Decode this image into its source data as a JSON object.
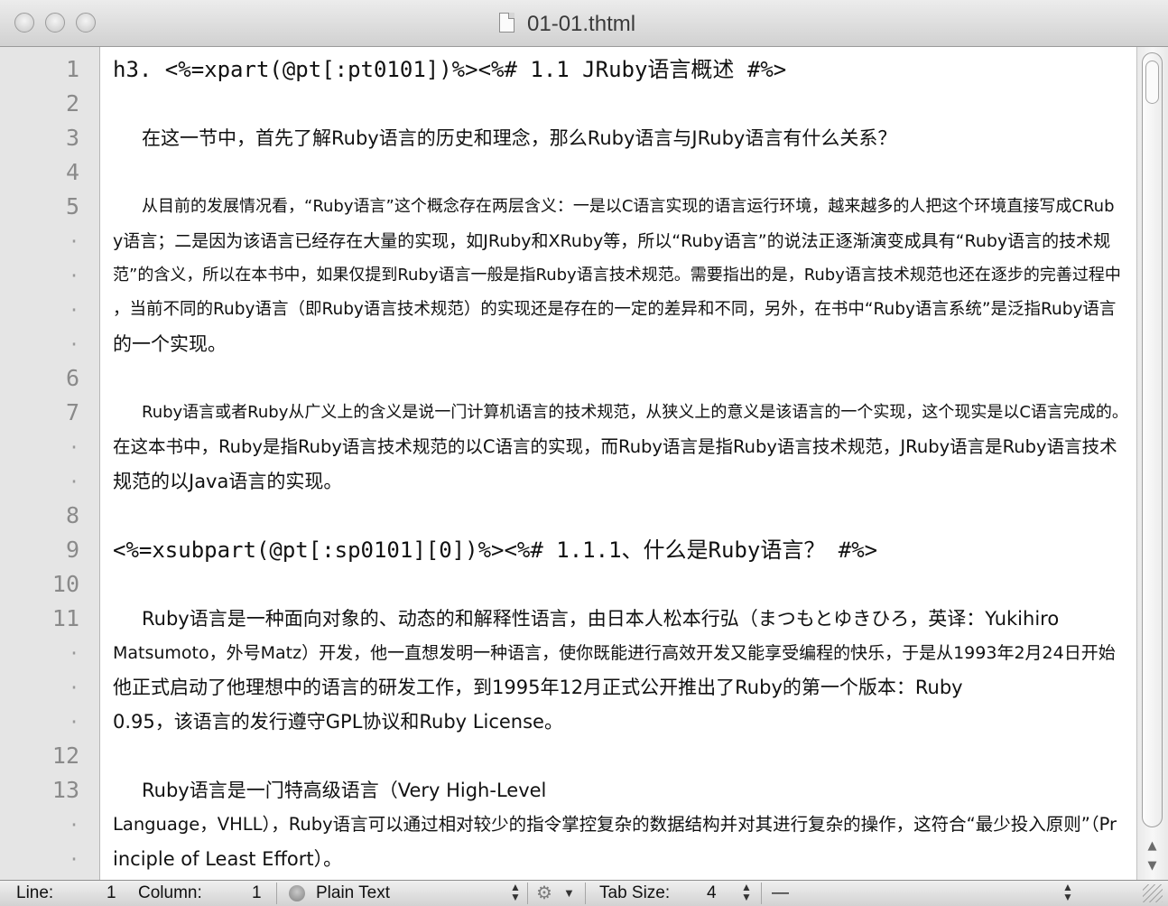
{
  "window": {
    "title": "01-01.thtml"
  },
  "gutter": [
    "1",
    "2",
    "3",
    "4",
    "5",
    "·",
    "·",
    "·",
    "·",
    "6",
    "7",
    "·",
    "·",
    "8",
    "9",
    "10",
    "11",
    "·",
    "·",
    "·",
    "12",
    "13",
    "·",
    "·"
  ],
  "lines": [
    "h3. <%=xpart(@pt[:pt0101])%><%# 1.1 JRuby语言概述 #%>",
    "",
    "在这一节中，首先了解Ruby语言的历史和理念，那么Ruby语言与JRuby语言有什么关系？",
    "",
    "从目前的发展情况看，“Ruby语言”这个概念存在两层含义：一是以C语言实现的语言运行环境，越来越多的人把这个环境直接写成CRub",
    "y语言；二是因为该语言已经存在大量的实现，如JRuby和XRuby等，所以“Ruby语言”的说法正逐渐演变成具有“Ruby语言的技术规",
    "范”的含义，所以在本书中，如果仅提到Ruby语言一般是指Ruby语言技术规范。需要指出的是，Ruby语言技术规范也还在逐步的完善过程中",
    "，当前不同的Ruby语言（即Ruby语言技术规范）的实现还是存在的一定的差异和不同，另外，在书中“Ruby语言系统”是泛指Ruby语言",
    "的一个实现。",
    "",
    "Ruby语言或者Ruby从广义上的含义是说一门计算机语言的技术规范，从狭义上的意义是该语言的一个实现，这个现实是以C语言完成的。",
    "在这本书中，Ruby是指Ruby语言技术规范的以C语言的实现，而Ruby语言是指Ruby语言技术规范，JRuby语言是Ruby语言技术",
    "规范的以Java语言的实现。",
    "",
    "<%=xsubpart(@pt[:sp0101][0])%><%# 1.1.1、什么是Ruby语言？ #%>",
    "",
    "Ruby语言是一种面向对象的、动态的和解释性语言，由日本人松本行弘（まつもとゆきひろ，英译：Yukihiro",
    "Matsumoto，外号Matz）开发，他一直想发明一种语言，使你既能进行高效开发又能享受编程的快乐，于是从1993年2月24日开始",
    "他正式启动了他理想中的语言的研发工作，到1995年12月正式公开推出了Ruby的第一个版本：Ruby",
    "0.95，该语言的发行遵守GPL协议和Ruby License。",
    "",
    "Ruby语言是一门特高级语言（Very High-Level",
    "Language，VHLL），Ruby语言可以通过相对较少的指令掌控复杂的数据结构并对其进行复杂的操作，这符合“最少投入原则”（Pr",
    "inciple of Least Effort）。"
  ],
  "statusbar": {
    "line_label": "Line:",
    "line_value": "1",
    "column_label": "Column:",
    "column_value": "1",
    "syntax": "Plain Text",
    "tab_size_label": "Tab Size:",
    "tab_size_value": "4",
    "symbol": "—"
  }
}
